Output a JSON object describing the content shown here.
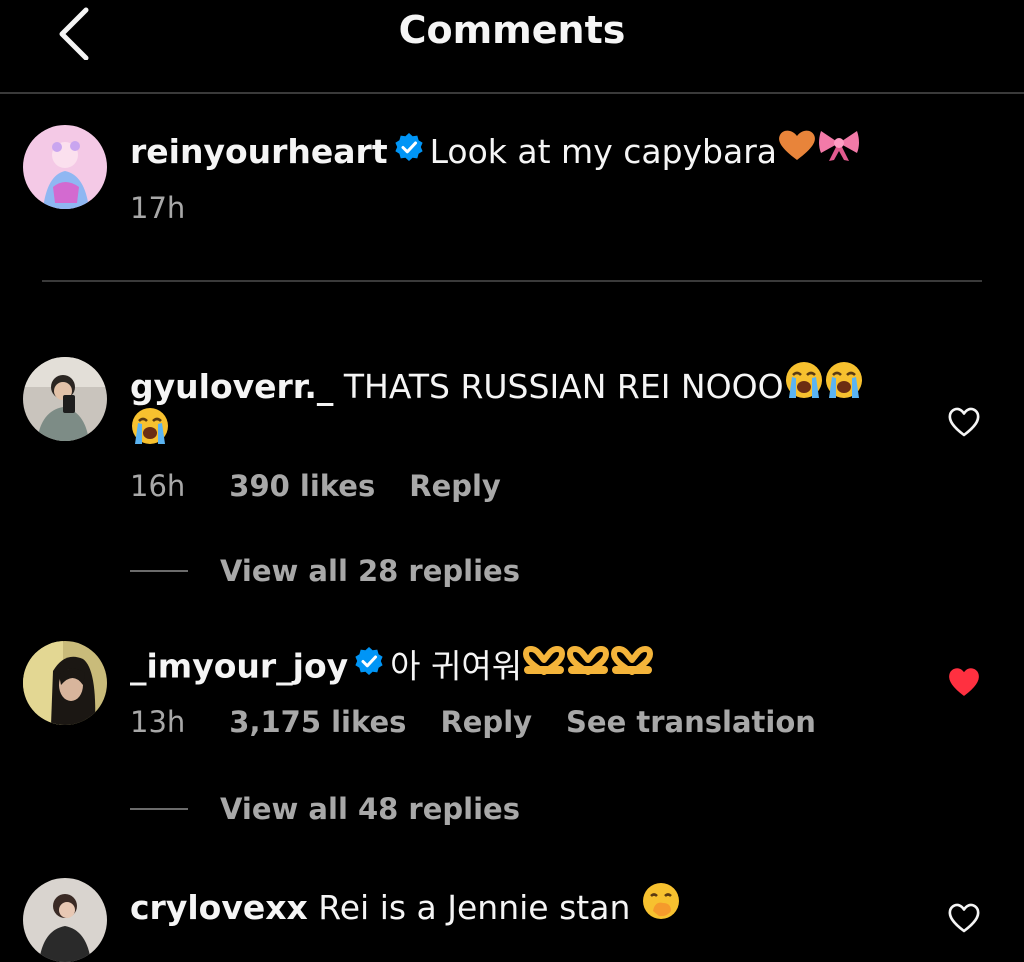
{
  "header": {
    "title": "Comments",
    "back_icon": "chevron-left-icon"
  },
  "caption": {
    "username": "reinyourheart",
    "verified": true,
    "text": "Look at my capybara",
    "emojis": [
      "orange-heart-emoji",
      "ribbon-emoji"
    ],
    "time": "17h"
  },
  "comments": [
    {
      "username": "gyuloverr._",
      "verified": false,
      "text": "THATS RUSSIAN REI NOOO",
      "emojis": [
        "loudly-crying-face-emoji",
        "loudly-crying-face-emoji",
        "loudly-crying-face-emoji"
      ],
      "time": "16h",
      "likes": "390 likes",
      "reply": "Reply",
      "liked": false,
      "view_replies": "View all 28 replies"
    },
    {
      "username": "_imyour_joy",
      "verified": true,
      "text": "아 귀여워",
      "emojis": [
        "heart-hands-emoji",
        "heart-hands-emoji",
        "heart-hands-emoji"
      ],
      "time": "13h",
      "likes": "3,175 likes",
      "reply": "Reply",
      "translate": "See translation",
      "liked": true,
      "view_replies": "View all 48 replies"
    },
    {
      "username": "crylovexx",
      "verified": false,
      "text": "Rei is a Jennie stan",
      "emojis": [
        "face-with-hand-over-mouth-emoji"
      ],
      "liked": false
    }
  ],
  "colors": {
    "background": "#000000",
    "text": "#f5f5f5",
    "secondary_text": "#a8a8a8",
    "verified_blue": "#0095f6",
    "liked_red": "#ff3040",
    "divider": "#3a3a3a"
  }
}
